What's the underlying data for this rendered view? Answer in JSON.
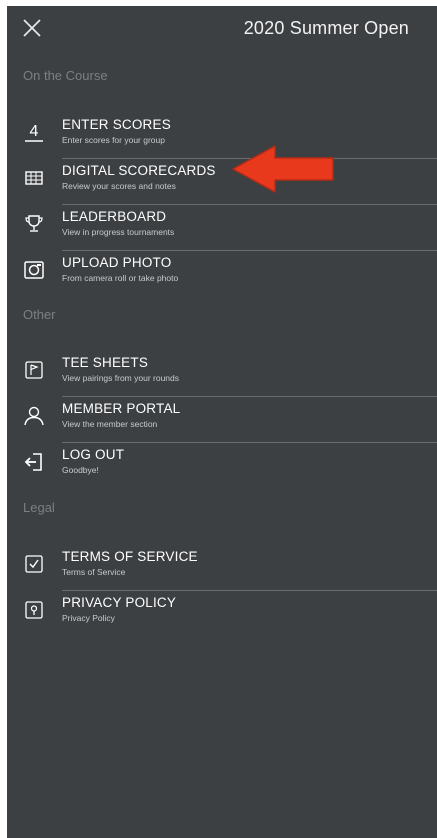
{
  "header": {
    "title": "2020 Summer Open",
    "close_icon": "close-icon"
  },
  "sections": {
    "on_course": {
      "label": "On the Course",
      "items": [
        {
          "title": "ENTER SCORES",
          "subtitle": "Enter scores for your group",
          "icon": "enter-scores-icon",
          "icon_text": "4"
        },
        {
          "title": "DIGITAL SCORECARDS",
          "subtitle": "Review your scores and notes",
          "icon": "scorecard-icon"
        },
        {
          "title": "LEADERBOARD",
          "subtitle": "View in progress tournaments",
          "icon": "trophy-icon"
        },
        {
          "title": "UPLOAD PHOTO",
          "subtitle": "From camera roll or take photo",
          "icon": "camera-icon"
        }
      ]
    },
    "other": {
      "label": "Other",
      "items": [
        {
          "title": "TEE SHEETS",
          "subtitle": "View pairings from your rounds",
          "icon": "flag-icon"
        },
        {
          "title": "MEMBER PORTAL",
          "subtitle": "View the member section",
          "icon": "user-icon"
        },
        {
          "title": "LOG OUT",
          "subtitle": "Goodbye!",
          "icon": "logout-icon"
        }
      ]
    },
    "legal": {
      "label": "Legal",
      "items": [
        {
          "title": "TERMS OF SERVICE",
          "subtitle": "Terms of Service",
          "icon": "checklist-icon"
        },
        {
          "title": "PRIVACY POLICY",
          "subtitle": "Privacy Policy",
          "icon": "lock-icon"
        }
      ]
    }
  },
  "colors": {
    "background": "#3d4043",
    "text": "#ffffff",
    "section_label": "#7b7f83",
    "divider": "#6a6d70",
    "annotation_arrow": "#e8391d"
  }
}
